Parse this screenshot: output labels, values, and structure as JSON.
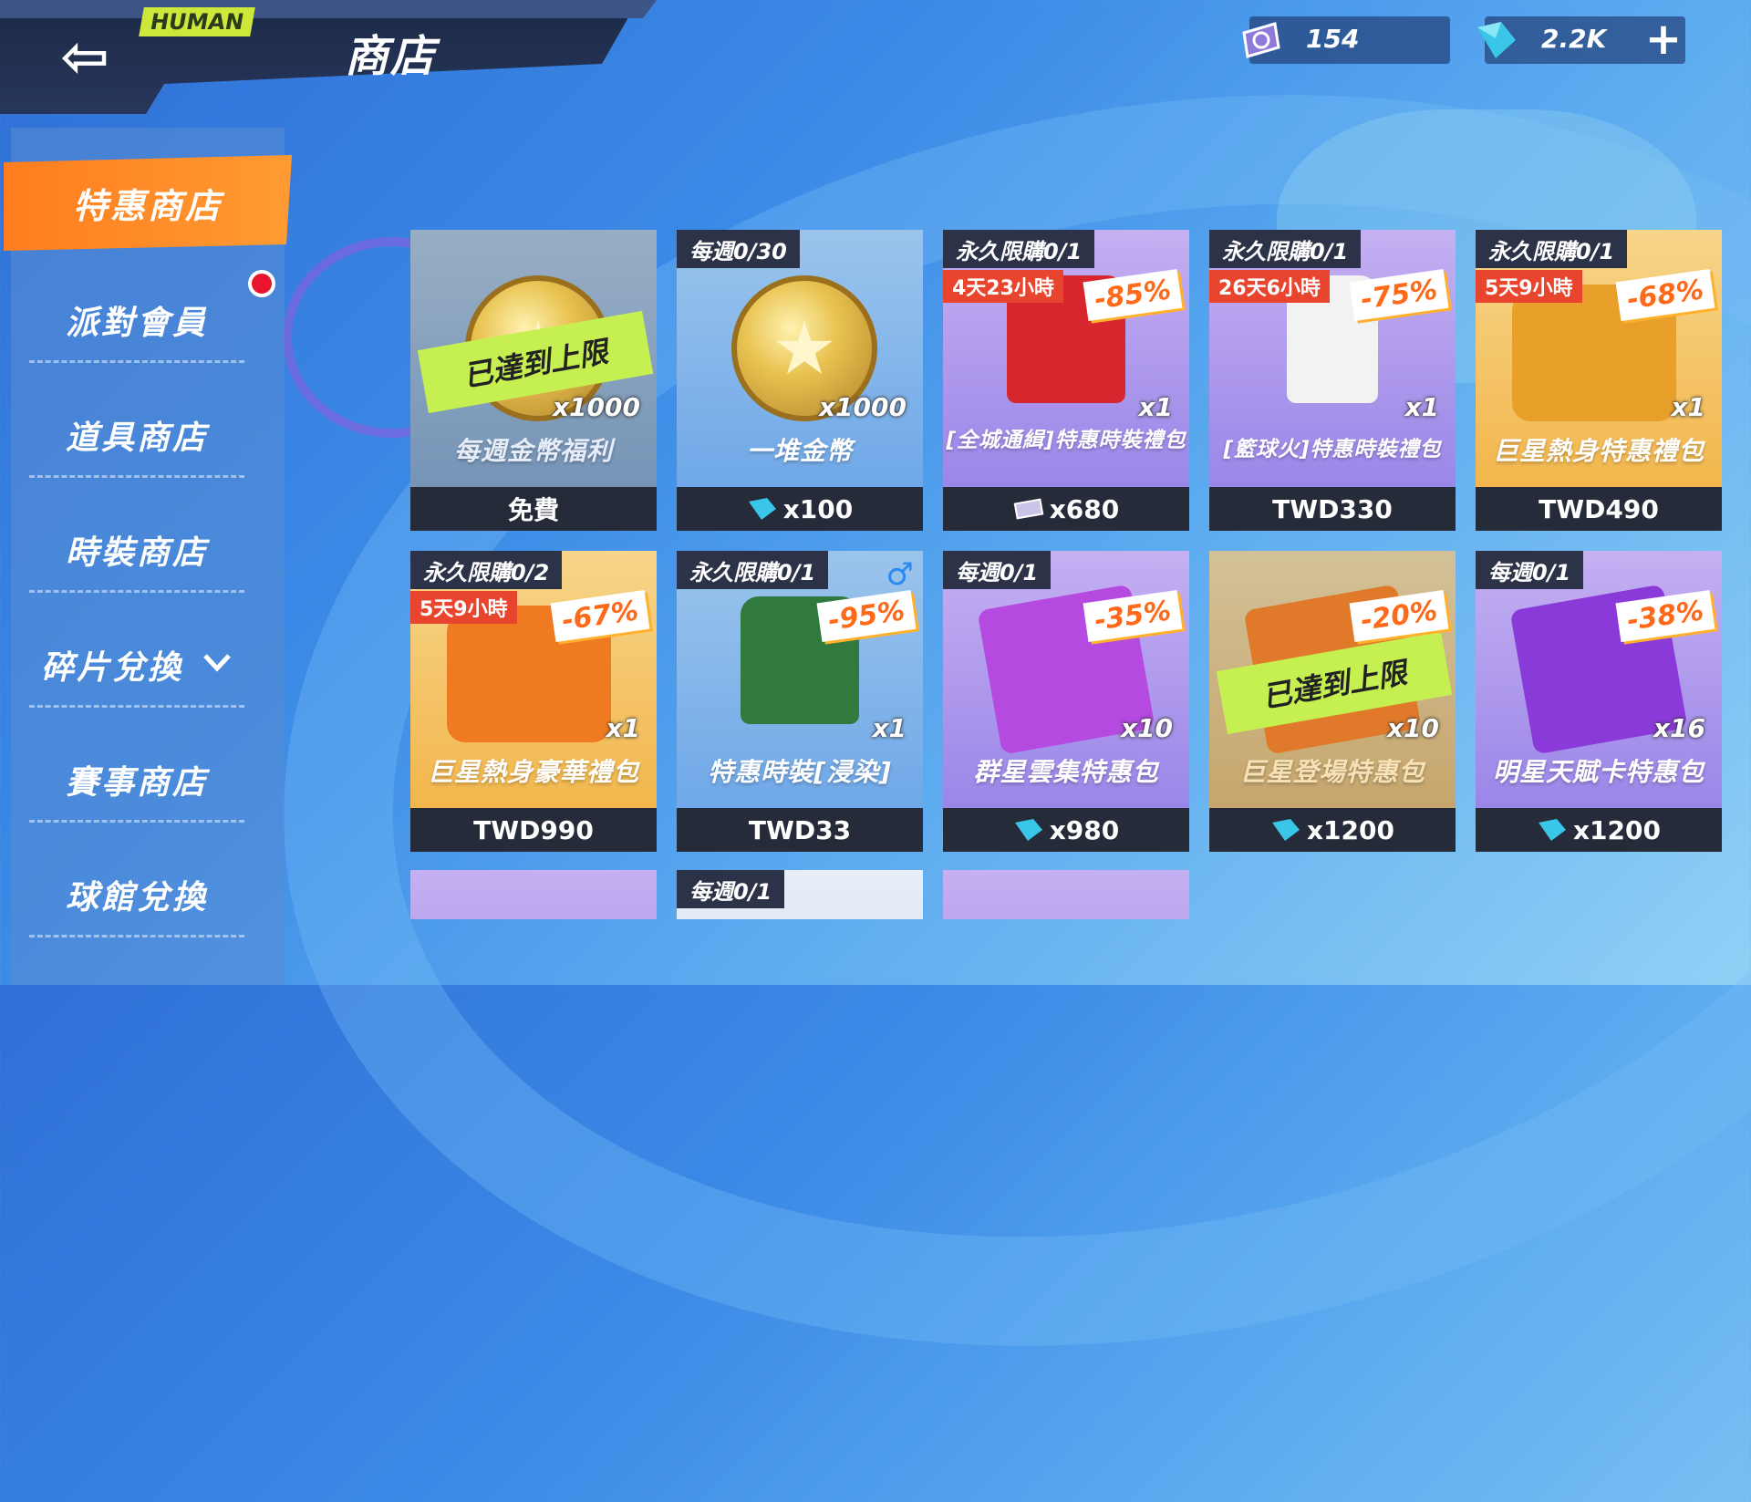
{
  "header": {
    "back_symbol": "⇦",
    "tag": "HUMAN",
    "title": "商店"
  },
  "currency": {
    "ticket": "154",
    "gems": "2.2K",
    "plus": "+"
  },
  "sidebar": {
    "items": [
      {
        "label": "特惠商店"
      },
      {
        "label": "派對會員"
      },
      {
        "label": "道具商店"
      },
      {
        "label": "時裝商店"
      },
      {
        "label": "碎片兌換"
      },
      {
        "label": "賽事商店"
      },
      {
        "label": "球館兌換"
      }
    ]
  },
  "maxed_label": "已達到上限",
  "cards": [
    {
      "name": "每週金幣福利",
      "qty": "x1000",
      "price": "免費",
      "limit": "",
      "timer": "",
      "discount": "",
      "theme": "blue",
      "maxed": true,
      "price_icon": ""
    },
    {
      "name": "一堆金幣",
      "qty": "x1000",
      "price": "x100",
      "limit": "每週0/30",
      "timer": "",
      "discount": "",
      "theme": "blue",
      "maxed": false,
      "price_icon": "gem-icon"
    },
    {
      "name": "[全城通緝]特惠時裝禮包",
      "qty": "x1",
      "price": "x680",
      "limit": "永久限購0/1",
      "timer": "4天23小時",
      "discount": "-85%",
      "theme": "purple",
      "maxed": false,
      "price_icon": "ticket-icon"
    },
    {
      "name": "[籃球火]特惠時裝禮包",
      "qty": "x1",
      "price": "TWD330",
      "limit": "永久限購0/1",
      "timer": "26天6小時",
      "discount": "-75%",
      "theme": "purple",
      "maxed": false,
      "price_icon": ""
    },
    {
      "name": "巨星熱身特惠禮包",
      "qty": "x1",
      "price": "TWD490",
      "limit": "永久限購0/1",
      "timer": "5天9小時",
      "discount": "-68%",
      "theme": "gold",
      "maxed": false,
      "price_icon": ""
    },
    {
      "name": "巨星熱身豪華禮包",
      "qty": "x1",
      "price": "TWD990",
      "limit": "永久限購0/2",
      "timer": "5天9小時",
      "discount": "-67%",
      "theme": "gold",
      "maxed": false,
      "price_icon": ""
    },
    {
      "name": "特惠時裝[浸染]",
      "qty": "x1",
      "price": "TWD33",
      "limit": "永久限購0/1",
      "timer": "",
      "discount": "-95%",
      "theme": "blue",
      "maxed": false,
      "price_icon": "",
      "gender": "♂"
    },
    {
      "name": "群星雲集特惠包",
      "qty": "x10",
      "price": "x980",
      "limit": "每週0/1",
      "timer": "",
      "discount": "-35%",
      "theme": "purple",
      "maxed": false,
      "price_icon": "gem-icon"
    },
    {
      "name": "巨星登場特惠包",
      "qty": "x10",
      "price": "x1200",
      "limit": "",
      "timer": "",
      "discount": "-20%",
      "theme": "gold",
      "maxed": true,
      "price_icon": "gem-icon"
    },
    {
      "name": "明星天賦卡特惠包",
      "qty": "x16",
      "price": "x1200",
      "limit": "每週0/1",
      "timer": "",
      "discount": "-38%",
      "theme": "purple",
      "maxed": false,
      "price_icon": "gem-icon"
    },
    {
      "name": "",
      "qty": "",
      "price": "",
      "limit": "",
      "timer": "",
      "discount": "",
      "theme": "purple",
      "maxed": false,
      "price_icon": ""
    },
    {
      "name": "",
      "qty": "",
      "price": "",
      "limit": "每週0/1",
      "timer": "",
      "discount": "",
      "theme": "blue",
      "maxed": false,
      "price_icon": ""
    },
    {
      "name": "",
      "qty": "",
      "price": "",
      "limit": "",
      "timer": "",
      "discount": "",
      "theme": "purple",
      "maxed": false,
      "price_icon": ""
    }
  ],
  "colors": {
    "accent_orange": "#ff8a25",
    "maxed_green": "#c6f051",
    "discount_orange": "#ff6a1a",
    "timer_red": "#e9442d",
    "price_bar": "#252b38"
  }
}
